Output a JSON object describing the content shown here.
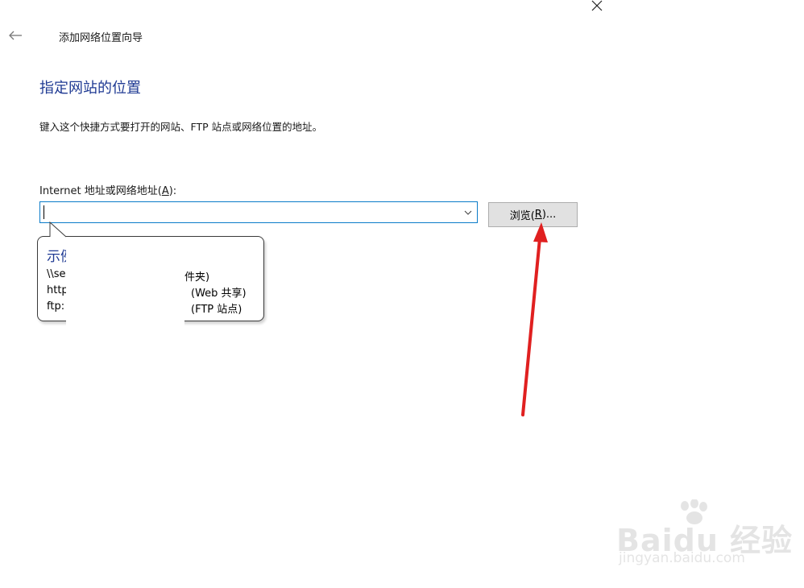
{
  "window": {
    "title": "添加网络位置向导",
    "close_icon": "close-icon",
    "back_icon": "back-arrow-icon"
  },
  "page": {
    "heading": "指定网站的位置",
    "instruction": "键入这个快捷方式要打开的网站、FTP 站点或网络位置的地址。"
  },
  "address": {
    "label_prefix": "Internet 地址或网络地址(",
    "label_accesskey": "A",
    "label_suffix": "):",
    "value": "",
    "dropdown_icon": "chevron-down-icon"
  },
  "browse": {
    "label_prefix": "浏览(",
    "label_accesskey": "R",
    "label_suffix": ")..."
  },
  "tooltip": {
    "title": "示例",
    "examples": [
      {
        "path": "\\\\se",
        "desc": "件夹)"
      },
      {
        "path": "http",
        "desc": "(Web 共享)"
      },
      {
        "path": "ftp:",
        "desc": "(FTP 站点)"
      }
    ]
  },
  "annotation": {
    "arrow_color": "#e02020"
  },
  "watermark": {
    "brand": "Baidu 经验",
    "url": "jingyan.baidu.com"
  },
  "colors": {
    "heading_blue": "#1f3a93",
    "input_border": "#0a7cc9",
    "button_bg": "#e1e1e1"
  }
}
